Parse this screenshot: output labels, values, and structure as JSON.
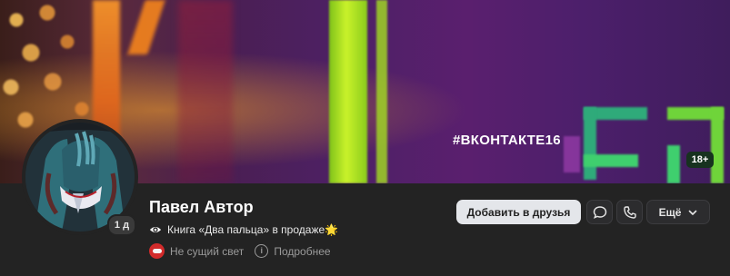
{
  "cover": {
    "hashtag": "#ВКОНТАКТЕ16",
    "age_badge": "18+"
  },
  "profile": {
    "name": "Павел Автор",
    "online_badge": "1 д",
    "status_text": "Книга «Два пальца» в продаже🌟",
    "community_label": "Не сущий свет",
    "more_info_label": "Подробнее"
  },
  "actions": {
    "add_friend_label": "Добавить в друзья",
    "message_icon": "chat-bubble-icon",
    "call_icon": "phone-icon",
    "more_label": "Ещё"
  },
  "colors": {
    "background": "#232323",
    "primary_button_bg": "#e4e6ea",
    "secondary_button_bg": "#2c2c2e",
    "muted_text": "#9a9a9a",
    "community_icon": "#d12a2a"
  }
}
